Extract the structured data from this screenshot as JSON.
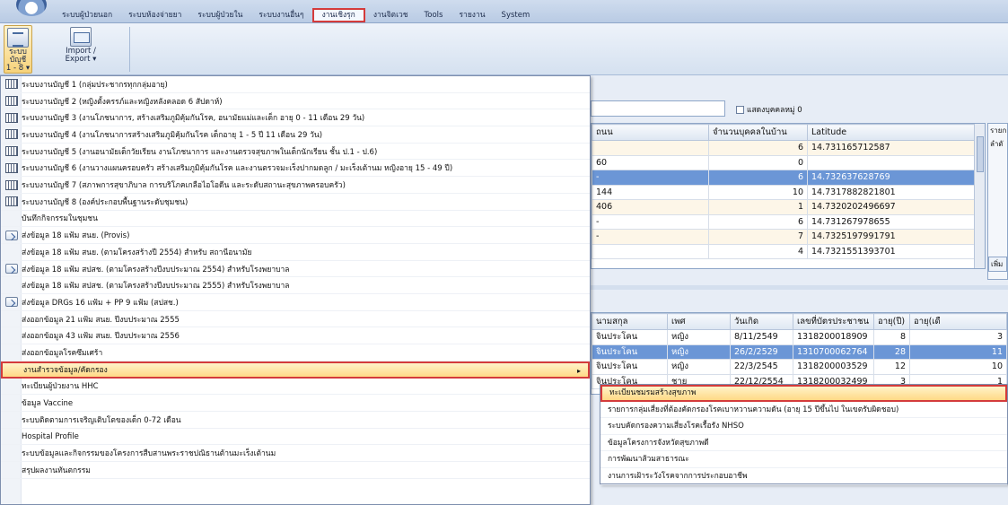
{
  "menubar": {
    "items": [
      {
        "label": "ระบบผู้ป่วยนอก",
        "active": false
      },
      {
        "label": "ระบบห้องจ่ายยา",
        "active": false
      },
      {
        "label": "ระบบผู้ป่วยใน",
        "active": false
      },
      {
        "label": "ระบบงานอื่นๆ",
        "active": false
      },
      {
        "label": "งานเชิงรุก",
        "active": true
      },
      {
        "label": "งานจิตเวช",
        "active": false
      },
      {
        "label": "Tools",
        "active": false
      },
      {
        "label": "รายงาน",
        "active": false
      },
      {
        "label": "System",
        "active": false
      }
    ]
  },
  "ribbon": {
    "btn1_line1": "ระบบบัญชี",
    "btn1_line2": "1 - 8 ▾",
    "btn2_line1": "Import /",
    "btn2_line2": "Export ▾"
  },
  "filter": {
    "checkbox_label": "แสดงบุคคลหมู่ 0"
  },
  "grid1": {
    "headers": [
      "ถนน",
      "จำนวนบุคคลในบ้าน",
      "Latitude"
    ],
    "rows": [
      [
        "",
        "6",
        "14.731165712587"
      ],
      [
        "60",
        "0",
        ""
      ],
      [
        "-",
        "6",
        "14.732637628769"
      ],
      [
        "144",
        "10",
        "14.7317882821801"
      ],
      [
        "406",
        "1",
        "14.7320202496697"
      ],
      [
        "-",
        "6",
        "14.731267978655"
      ],
      [
        "-",
        "7",
        "14.7325197991791"
      ],
      [
        "",
        "4",
        "14.7321551393701"
      ]
    ]
  },
  "grid2": {
    "headers": [
      "นามสกุล",
      "เพศ",
      "วันเกิด",
      "เลขที่บัตรประชาชน",
      "อายุ(ปี)",
      "อายุ(เดื"
    ],
    "rows": [
      [
        "จินประโคน",
        "หญิง",
        "8/11/2549",
        "1318200018909",
        "8",
        "3"
      ],
      [
        "จินประโคน",
        "หญิง",
        "26/2/2529",
        "1310700062764",
        "28",
        "11"
      ],
      [
        "จินประโคน",
        "หญิง",
        "22/3/2545",
        "1318200003529",
        "12",
        "10"
      ],
      [
        "จินประโคน",
        "ชาย",
        "22/12/2554",
        "1318200032499",
        "3",
        "1"
      ]
    ]
  },
  "right_panel": {
    "heading": "รายก",
    "sub": "ลำดั",
    "btn": "เพิ่ม"
  },
  "dropdown": {
    "items": [
      {
        "icon": "grid",
        "label": "ระบบงานบัญชี 1 (กลุ่มประชากรทุกกลุ่มอายุ)"
      },
      {
        "icon": "grid",
        "label": "ระบบงานบัญชี 2 (หญิงตั้งครรภ์และหญิงหลังคลอด 6 สัปดาห์)"
      },
      {
        "icon": "grid",
        "label": "ระบบงานบัญชี 3 (งานโภชนาการ, สร้างเสริมภูมิคุ้มกันโรค, อนามัยแม่และเด็ก อายุ 0 - 11 เดือน 29 วัน)"
      },
      {
        "icon": "grid",
        "label": "ระบบงานบัญชี 4 (งานโภชนาการสร้างเสริมภูมิคุ้มกันโรค เด็กอายุ 1 - 5 ปี 11 เดือน 29 วัน)"
      },
      {
        "icon": "grid",
        "label": "ระบบงานบัญชี 5 (งานอนามัยเด็กวัยเรียน งานโภชนาการ และงานตรวจสุขภาพในเด็กนักเรียน ชั้น ป.1 - ป.6)"
      },
      {
        "icon": "grid",
        "label": "ระบบงานบัญชี 6 (งานวางแผนครอบครัว สร้างเสริมภูมิคุ้มกันโรค และงานตรวจมะเร็งปากมดลูก / มะเร็งเต้านม หญิงอายุ 15 - 49 ปี)"
      },
      {
        "icon": "grid",
        "label": "ระบบงานบัญชี 7 (สภาพการสุขาภิบาล การบริโภคเกลือไอโอดีน และระดับสถานะสุขภาพครอบครัว)"
      },
      {
        "icon": "grid",
        "label": "ระบบงานบัญชี 8 (องค์ประกอบพื้นฐานระดับชุมชน)"
      },
      {
        "icon": "none",
        "label": "บันทึกกิจกรรมในชุมชน"
      },
      {
        "icon": "arrow",
        "label": "ส่งข้อมูล 18 แฟ้ม สนย. (Provis)"
      },
      {
        "icon": "none",
        "label": "ส่งข้อมูล 18 แฟ้ม สนย. (ตามโครงสร้างปี 2554) สำหรับ สถานีอนามัย"
      },
      {
        "icon": "arrow",
        "label": "ส่งข้อมูล 18 แฟ้ม สปสช. (ตามโครงสร้างปีงบประมาณ 2554) สำหรับโรงพยาบาล"
      },
      {
        "icon": "none",
        "label": "ส่งข้อมูล 18 แฟ้ม สปสช. (ตามโครงสร้างปีงบประมาณ 2555) สำหรับโรงพยาบาล"
      },
      {
        "icon": "arrow",
        "label": "ส่งข้อมูล DRGs 16 แฟ้ม + PP 9 แฟ้ม (สปสช.)"
      },
      {
        "icon": "none",
        "label": "ส่งออกข้อมูล 21 แฟ้ม สนย. ปีงบประมาณ 2555"
      },
      {
        "icon": "none",
        "label": "ส่งออกข้อมูล 43 แฟ้ม สนย. ปีงบประมาณ 2556"
      },
      {
        "icon": "none",
        "label": "ส่งออกข้อมูลโรคซึมเศร้า"
      },
      {
        "icon": "none",
        "label": "งานสำรวจข้อมูล/คัดกรอง",
        "highlight": true,
        "submenu": true
      },
      {
        "icon": "none",
        "label": "ทะเบียนผู้ป่วยงาน HHC"
      },
      {
        "icon": "none",
        "label": "ข้อมูล Vaccine"
      },
      {
        "icon": "none",
        "label": "ระบบติดตามการเจริญเติบโตของเด็ก 0-72 เดือน"
      },
      {
        "icon": "none",
        "label": "Hospital Profile"
      },
      {
        "icon": "none",
        "label": "ระบบข้อมูลและกิจกรรมของโครงการสืบสานพระราชปณิธานต้านมะเร็งเต้านม"
      },
      {
        "icon": "none",
        "label": "สรุปผลงานทันตกรรม"
      }
    ]
  },
  "submenu": {
    "items": [
      {
        "label": "ทะเบียนชมรมสร้างสุขภาพ",
        "highlight": true
      },
      {
        "label": "รายการกลุ่มเสี่ยงที่ต้องคัดกรองโรคเบาหวานความดัน (อายุ 15 ปีขึ้นไป ในเขตรับผิดชอบ)"
      },
      {
        "label": "ระบบคัดกรองความเสี่ยงโรคเรื้อรัง NHSO"
      },
      {
        "label": "ข้อมูลโครงการจังหวัดสุขภาพดี"
      },
      {
        "label": "การพัฒนาส้วมสาธารณะ"
      },
      {
        "label": "งานการเฝ้าระวังโรคจากการประกอบอาชีพ"
      }
    ]
  }
}
